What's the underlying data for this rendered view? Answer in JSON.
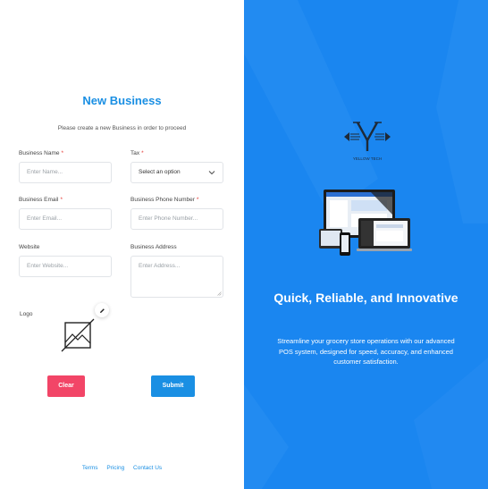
{
  "form": {
    "title": "New Business",
    "subtitle": "Please create a new Business in order to proceed",
    "fields": {
      "business_name": {
        "label": "Business Name",
        "required": "*",
        "placeholder": "Enter Name..."
      },
      "tax": {
        "label": "Tax",
        "required": "*",
        "value": "Select an option"
      },
      "business_email": {
        "label": "Business Email",
        "required": "*",
        "placeholder": "Enter Email..."
      },
      "business_phone": {
        "label": "Business Phone Number",
        "required": "*",
        "placeholder": "Enter Phone Number..."
      },
      "website": {
        "label": "Website",
        "placeholder": "Enter Website..."
      },
      "business_address": {
        "label": "Business Address",
        "placeholder": "Enter Address..."
      }
    },
    "logo_label": "Logo",
    "buttons": {
      "clear": "Clear",
      "submit": "Submit"
    }
  },
  "footer": {
    "links": [
      "Terms",
      "Pricing",
      "Contact Us"
    ]
  },
  "promo": {
    "brand_text": "YELLOW TECH",
    "title": "Quick, Reliable, and Innovative",
    "text": "Streamline your grocery store operations with our advanced POS system, designed for speed, accuracy, and enhanced customer satisfaction."
  },
  "colors": {
    "accent": "#1a8fe3",
    "danger": "#f24567",
    "panel": "#1a86f0",
    "required": "#e53935"
  },
  "icons": {
    "logo_placeholder": "image-off-icon",
    "edit": "pencil-icon",
    "tax_dropdown": "chevron-down-icon"
  }
}
